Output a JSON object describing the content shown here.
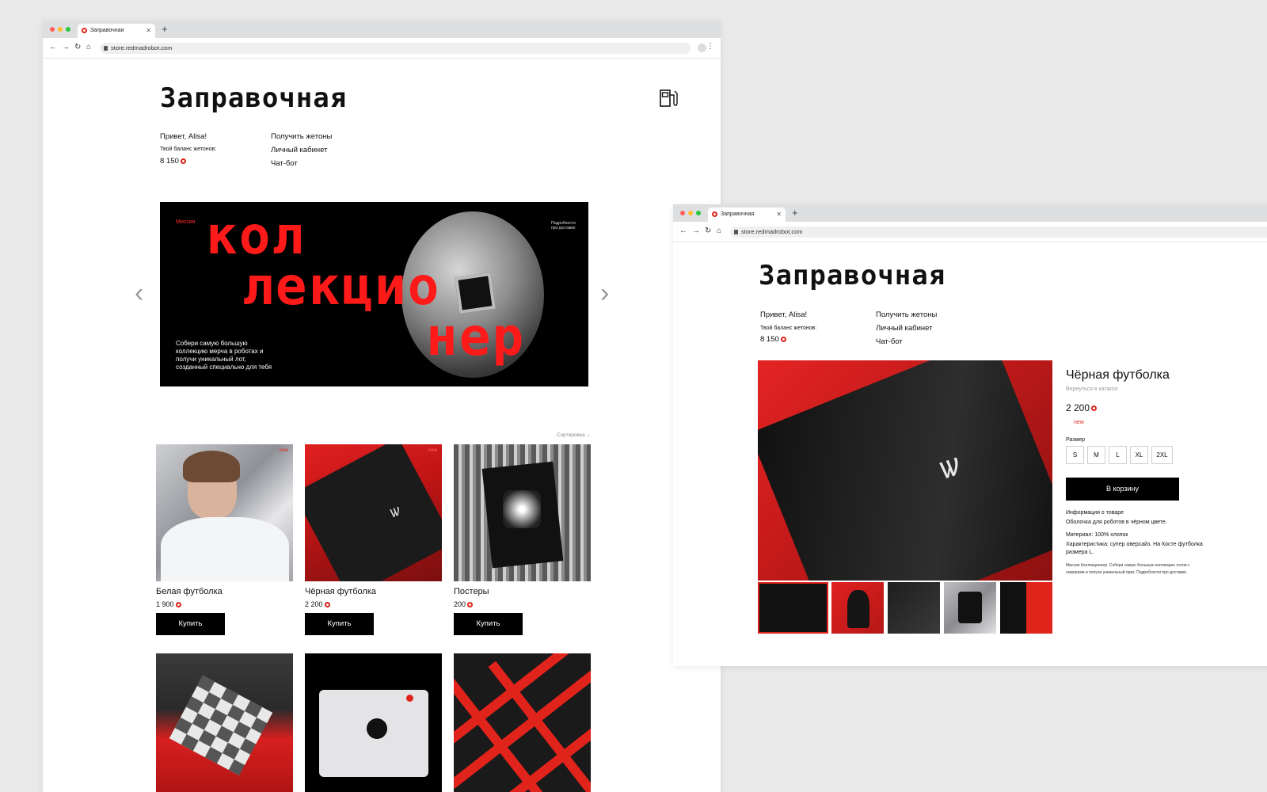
{
  "windows": [
    {
      "tab_title": "Заправочная",
      "url": "store.redmadrobot.com",
      "header": {
        "title": "Заправочная",
        "greeting": "Привет, Alisa!",
        "balance_label": "Твой баланс жетонов:",
        "balance_value": "8 150",
        "nav": [
          "Получить жетоны",
          "Личный кабинет",
          "Чат-бот"
        ]
      },
      "hero": {
        "tag": "Миссия",
        "headline_line1": "кол",
        "headline_line2": "лекцио",
        "headline_line3": "нер",
        "delivery_note": "Подробности про доставке",
        "description": "Собери самую большую коллекцию мерча в роботах и получи уникальный лот, созданный специально для тебя"
      },
      "sort_label": "Сортировка",
      "products": [
        {
          "name": "Белая футболка",
          "price": "1 900",
          "buy": "Купить",
          "badge": "new"
        },
        {
          "name": "Чёрная футболка",
          "price": "2 200",
          "buy": "Купить",
          "badge": "new"
        },
        {
          "name": "Постеры",
          "price": "200",
          "buy": "Купить",
          "badge": ""
        }
      ]
    },
    {
      "tab_title": "Заправочная",
      "url": "store.redmadrobot.com",
      "header": {
        "title": "Заправочная",
        "greeting": "Привет, Alisa!",
        "balance_label": "Твой баланс жетонов:",
        "balance_value": "8 150",
        "nav": [
          "Получить жетоны",
          "Личный кабинет",
          "Чат-бот"
        ]
      },
      "product": {
        "title": "Чёрная футболка",
        "back_link": "Вернуться в каталог",
        "price": "2 200",
        "badge": "new",
        "size_label": "Размер",
        "sizes": [
          "S",
          "M",
          "L",
          "XL",
          "2XL"
        ],
        "cart_button": "В корзину",
        "info_title": "Информация о товаре",
        "info_desc": "Оболочка для роботов в чёрном цвете.",
        "material": "Материал: 100% хлопок",
        "characteristic": "Характеристика: супер оверсайз. На Косте футболка размера L.",
        "mission_note": "Миссия Коллекционер. Собери самую большую коллекцию лотов с номерами и получи уникальный приз. Подробности про доставке."
      }
    }
  ],
  "colors": {
    "accent": "#e0231b",
    "black": "#000000",
    "bg": "#e9e9ea"
  }
}
